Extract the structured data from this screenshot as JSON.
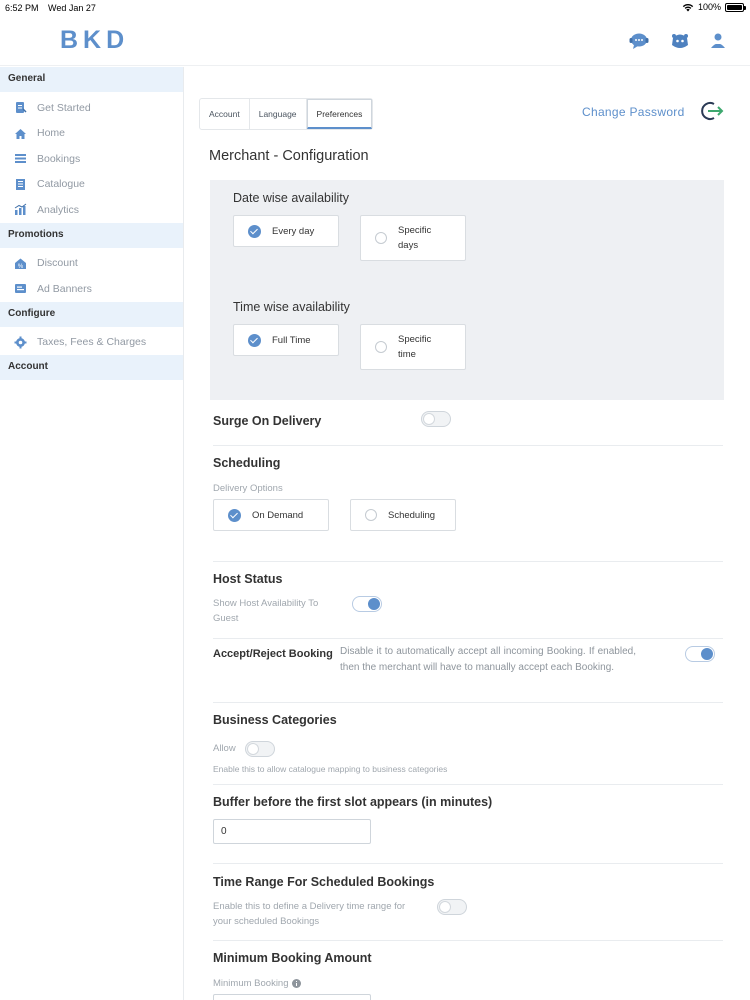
{
  "status": {
    "time": "6:52 PM",
    "date": "Wed Jan 27",
    "battery": "100%"
  },
  "brand": {
    "logo": "BKD",
    "accent": "#5d8fcb"
  },
  "header_icons": [
    "chat-support-icon",
    "bot-face-icon",
    "user-profile-icon"
  ],
  "sidebar": {
    "general": {
      "title": "General",
      "items": [
        {
          "label": "Get Started",
          "icon": "get-started-icon"
        },
        {
          "label": "Home",
          "icon": "home-icon"
        },
        {
          "label": "Bookings",
          "icon": "bookings-icon"
        },
        {
          "label": "Catalogue",
          "icon": "catalogue-icon"
        },
        {
          "label": "Analytics",
          "icon": "analytics-icon"
        }
      ]
    },
    "promotions": {
      "title": "Promotions",
      "items": [
        {
          "label": "Discount",
          "icon": "discount-icon"
        },
        {
          "label": "Ad Banners",
          "icon": "ad-banner-icon"
        }
      ]
    },
    "configure": {
      "title": "Configure",
      "items": [
        {
          "label": "Taxes, Fees & Charges",
          "icon": "gear-icon"
        }
      ]
    },
    "account": {
      "title": "Account"
    }
  },
  "tabs": [
    {
      "label": "Account",
      "active": false
    },
    {
      "label": "Language",
      "active": false
    },
    {
      "label": "Preferences",
      "active": true
    }
  ],
  "change_password": "Change Password",
  "page_title": "Merchant - Configuration",
  "date_avail": {
    "title": "Date wise availability",
    "options": [
      {
        "label": "Every day",
        "checked": true
      },
      {
        "label": "Specific days",
        "checked": false
      }
    ]
  },
  "time_avail": {
    "title": "Time wise availability",
    "options": [
      {
        "label": "Full Time",
        "checked": true
      },
      {
        "label": "Specific time",
        "checked": false
      }
    ]
  },
  "surge": {
    "title": "Surge On Delivery",
    "enabled": false
  },
  "scheduling": {
    "title": "Scheduling",
    "sub": "Delivery Options",
    "options": [
      {
        "label": "On Demand",
        "checked": true
      },
      {
        "label": "Scheduling",
        "checked": false
      }
    ]
  },
  "host_status": {
    "title": "Host Status",
    "toggle_label": "Show Host Availability To Guest",
    "enabled": true
  },
  "accept_reject": {
    "title": "Accept/Reject Booking",
    "desc": "Disable it to automatically accept all incoming Booking. If enabled, then the merchant will have to manually accept each Booking.",
    "enabled": true
  },
  "business_categories": {
    "title": "Business Categories",
    "allow_label": "Allow",
    "enabled": false,
    "hint": "Enable this to allow catalogue mapping to business categories"
  },
  "buffer": {
    "title": "Buffer before the first slot appears (in minutes)",
    "value": "0"
  },
  "time_range": {
    "title": "Time Range For Scheduled Bookings",
    "desc": "Enable this to define a Delivery time range for your scheduled Bookings",
    "enabled": false
  },
  "min_booking": {
    "title": "Minimum Booking Amount",
    "label": "Minimum Booking"
  }
}
